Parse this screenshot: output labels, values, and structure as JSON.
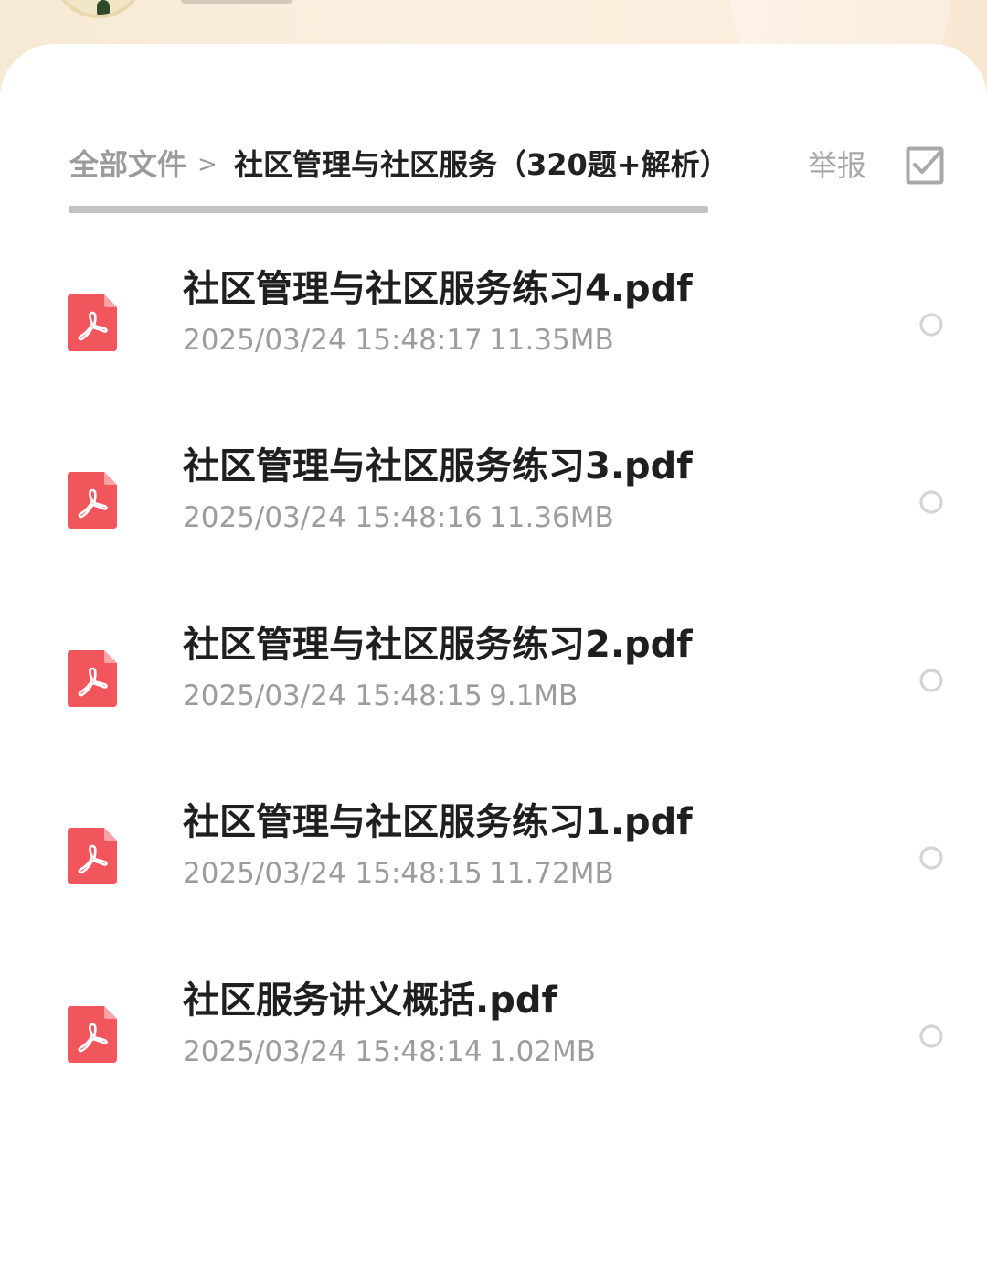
{
  "colors": {
    "pdf_icon_red": "#f0565c",
    "title_text": "#1f1f1f",
    "meta_text": "#9c9c9c",
    "breadcrumb_muted": "#9b9b9b",
    "scroll_indicator": "#c2c2c2",
    "header_bg": "#fbf0e0"
  },
  "breadcrumb": {
    "root": "全部文件",
    "separator": ">",
    "current": "社区管理与社区服务（320题+解析）"
  },
  "actions": {
    "report_label": "举报",
    "multiselect_icon": "checkbox-icon"
  },
  "files": [
    {
      "name": "社区管理与社区服务练习4.pdf",
      "time": "2025/03/24 15:48:17",
      "size": "11.35MB",
      "icon": "pdf-icon"
    },
    {
      "name": "社区管理与社区服务练习3.pdf",
      "time": "2025/03/24 15:48:16",
      "size": "11.36MB",
      "icon": "pdf-icon"
    },
    {
      "name": "社区管理与社区服务练习2.pdf",
      "time": "2025/03/24 15:48:15",
      "size": "9.1MB",
      "icon": "pdf-icon"
    },
    {
      "name": "社区管理与社区服务练习1.pdf",
      "time": "2025/03/24 15:48:15",
      "size": "11.72MB",
      "icon": "pdf-icon"
    },
    {
      "name": "社区服务讲义概括.pdf",
      "time": "2025/03/24 15:48:14",
      "size": "1.02MB",
      "icon": "pdf-icon"
    }
  ]
}
